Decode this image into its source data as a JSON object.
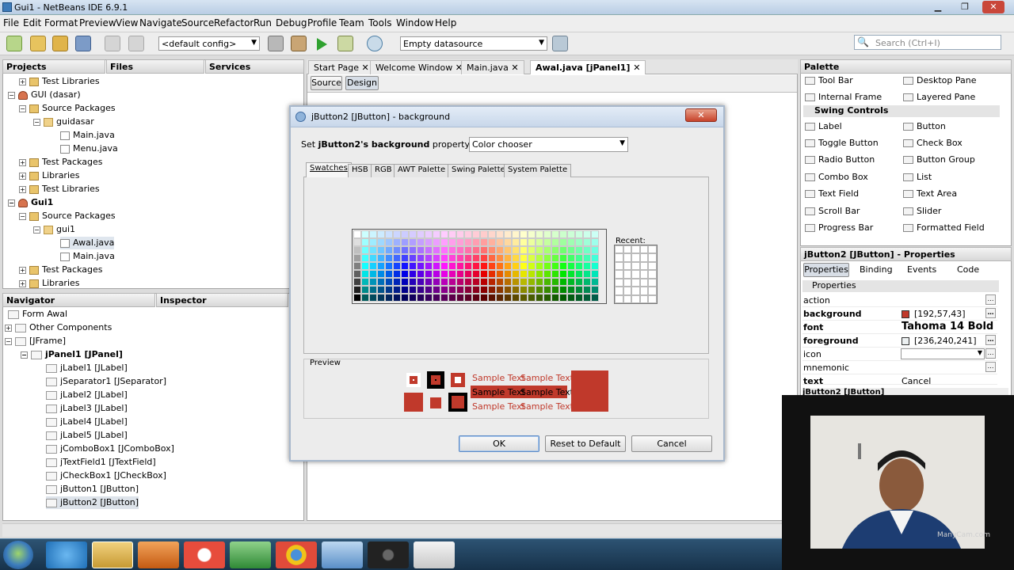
{
  "window": {
    "title": "Gui1 - NetBeans IDE 6.9.1"
  },
  "menu": [
    "File",
    "Edit",
    "Format",
    "Preview",
    "View",
    "Navigate",
    "Source",
    "Refactor",
    "Run",
    "Debug",
    "Profile",
    "Team",
    "Tools",
    "Window",
    "Help"
  ],
  "toolbar": {
    "config": "<default config>",
    "datasource": "Empty datasource",
    "search_placeholder": "Search (Ctrl+I)"
  },
  "projects_panel": {
    "tabs": [
      "Projects",
      "Files",
      "Services"
    ],
    "rows": [
      {
        "label": "Test Libraries"
      },
      {
        "label": "GUI (dasar)"
      },
      {
        "label": "Source Packages"
      },
      {
        "label": "guidasar"
      },
      {
        "label": "Main.java"
      },
      {
        "label": "Menu.java"
      },
      {
        "label": "Test Packages"
      },
      {
        "label": "Libraries"
      },
      {
        "label": "Test Libraries"
      },
      {
        "label": "Gui1"
      },
      {
        "label": "Source Packages"
      },
      {
        "label": "gui1"
      },
      {
        "label": "Awal.java"
      },
      {
        "label": "Main.java"
      },
      {
        "label": "Test Packages"
      },
      {
        "label": "Libraries"
      }
    ]
  },
  "navigator_panel": {
    "tabs": [
      "Navigator",
      "Inspector"
    ],
    "rows": [
      {
        "label": "Form Awal"
      },
      {
        "label": "Other Components"
      },
      {
        "label": "[JFrame]"
      },
      {
        "label": "jPanel1 [JPanel]"
      },
      {
        "label": "jLabel1 [JLabel]"
      },
      {
        "label": "jSeparator1 [JSeparator]"
      },
      {
        "label": "jLabel2 [JLabel]"
      },
      {
        "label": "jLabel3 [JLabel]"
      },
      {
        "label": "jLabel4 [JLabel]"
      },
      {
        "label": "jLabel5 [JLabel]"
      },
      {
        "label": "jComboBox1 [JComboBox]"
      },
      {
        "label": "jTextField1 [JTextField]"
      },
      {
        "label": "jCheckBox1 [JCheckBox]"
      },
      {
        "label": "jButton1 [JButton]"
      },
      {
        "label": "jButton2 [JButton]"
      }
    ]
  },
  "editor": {
    "tabs": [
      "Start Page",
      "Welcome Window",
      "Main.java",
      "Awal.java [jPanel1]"
    ],
    "modes": [
      "Source",
      "Design"
    ]
  },
  "dialog": {
    "title": "jButton2 [JButton] - background",
    "set_prefix": "Set ",
    "set_bold": "jButton2's background",
    "set_suffix": " property using:",
    "editor_choice": "Color chooser",
    "tabs": [
      "Swatches",
      "HSB",
      "RGB",
      "AWT Palette",
      "Swing Palette",
      "System Palette"
    ],
    "recent_label": "Recent:",
    "preview_label": "Preview",
    "sample_text": "Sample Text",
    "buttons": {
      "ok": "OK",
      "reset": "Reset to Default",
      "cancel": "Cancel"
    }
  },
  "palette": {
    "title": "Palette",
    "items": [
      [
        "Tool Bar",
        "Desktop Pane"
      ],
      [
        "Internal Frame",
        "Layered Pane"
      ]
    ],
    "section": "Swing Controls",
    "controls": [
      [
        "Label",
        "Button"
      ],
      [
        "Toggle Button",
        "Check Box"
      ],
      [
        "Radio Button",
        "Button Group"
      ],
      [
        "Combo Box",
        "List"
      ],
      [
        "Text Field",
        "Text Area"
      ],
      [
        "Scroll Bar",
        "Slider"
      ],
      [
        "Progress Bar",
        "Formatted Field"
      ]
    ]
  },
  "properties": {
    "title": "jButton2 [JButton] - Properties",
    "tabs": [
      "Properties",
      "Binding",
      "Events",
      "Code"
    ],
    "section": "Properties",
    "rows": [
      {
        "name": "action",
        "value": "",
        "bold": false
      },
      {
        "name": "background",
        "value": "[192,57,43]",
        "bold": true
      },
      {
        "name": "font",
        "value": "Tahoma 14 Bold",
        "bold": true
      },
      {
        "name": "foreground",
        "value": "[236,240,241]",
        "bold": true
      },
      {
        "name": "icon",
        "value": "",
        "bold": false
      },
      {
        "name": "mnemonic",
        "value": "",
        "bold": false
      },
      {
        "name": "text",
        "value": "Cancel",
        "bold": true
      }
    ],
    "footer": "jButton2 [JButton]"
  },
  "colors": {
    "accent": "#c0392b",
    "foreground_swatch": "#ecf0f1"
  },
  "webcam_watermark": "ManyCam.com"
}
